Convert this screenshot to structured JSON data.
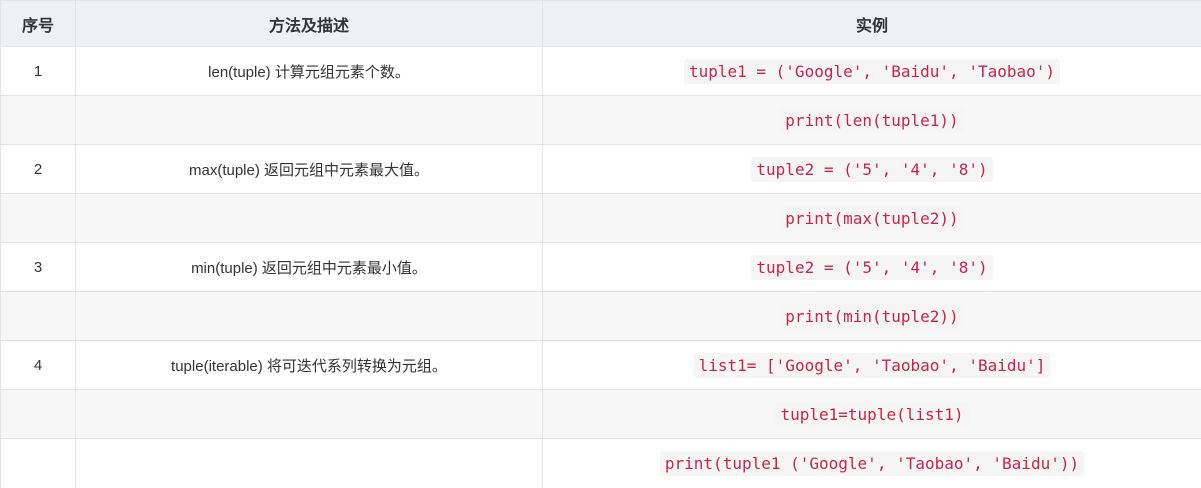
{
  "header": {
    "col1": "序号",
    "col2": "方法及描述",
    "col3": "实例"
  },
  "rows": [
    {
      "num": "1",
      "desc": "len(tuple) 计算元组元素个数。",
      "code": "tuple1 = ('Google', 'Baidu', 'Taobao')"
    },
    {
      "num": "",
      "desc": "",
      "code": "print(len(tuple1))"
    },
    {
      "num": "2",
      "desc": "max(tuple) 返回元组中元素最大值。",
      "code": "tuple2 = ('5', '4', '8')"
    },
    {
      "num": "",
      "desc": "",
      "code": "print(max(tuple2))"
    },
    {
      "num": "3",
      "desc": "min(tuple) 返回元组中元素最小值。",
      "code": "tuple2 = ('5', '4', '8')"
    },
    {
      "num": "",
      "desc": "",
      "code": "print(min(tuple2))"
    },
    {
      "num": "4",
      "desc": "tuple(iterable) 将可迭代系列转换为元组。",
      "code": "list1= ['Google', 'Taobao', 'Baidu']"
    },
    {
      "num": "",
      "desc": "",
      "code": "tuple1=tuple(list1)"
    },
    {
      "num": "",
      "desc": "",
      "code": "print(tuple1 ('Google', 'Taobao', 'Baidu'))"
    }
  ],
  "colors": {
    "header_bg": "#eef0f2",
    "border": "#e1e4e8",
    "code_text": "#c7254e",
    "code_bg": "#f5f5f5",
    "alt_row_bg": "#f7f7f7"
  }
}
